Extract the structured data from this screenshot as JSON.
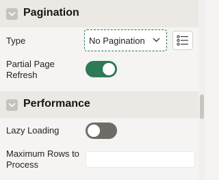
{
  "pagination": {
    "title": "Pagination",
    "type_label": "Type",
    "type_value": "No Pagination",
    "partial_refresh_label_line1": "Partial Page",
    "partial_refresh_label_line2": "Refresh",
    "partial_refresh_on": true
  },
  "performance": {
    "title": "Performance",
    "lazy_loading_label": "Lazy Loading",
    "lazy_loading_on": false,
    "max_rows_label_line1": "Maximum Rows to",
    "max_rows_label_line2": "Process",
    "max_rows_value": ""
  },
  "icons": {
    "collapse": "chevron-down-icon",
    "select_caret": "chevron-down-icon",
    "list_of_values": "list-icon"
  },
  "colors": {
    "toggle_on": "#2d7a55",
    "toggle_off": "#6f6b66",
    "focus_border": "#2e6e4f",
    "section_header_bg": "#ece9e5"
  }
}
